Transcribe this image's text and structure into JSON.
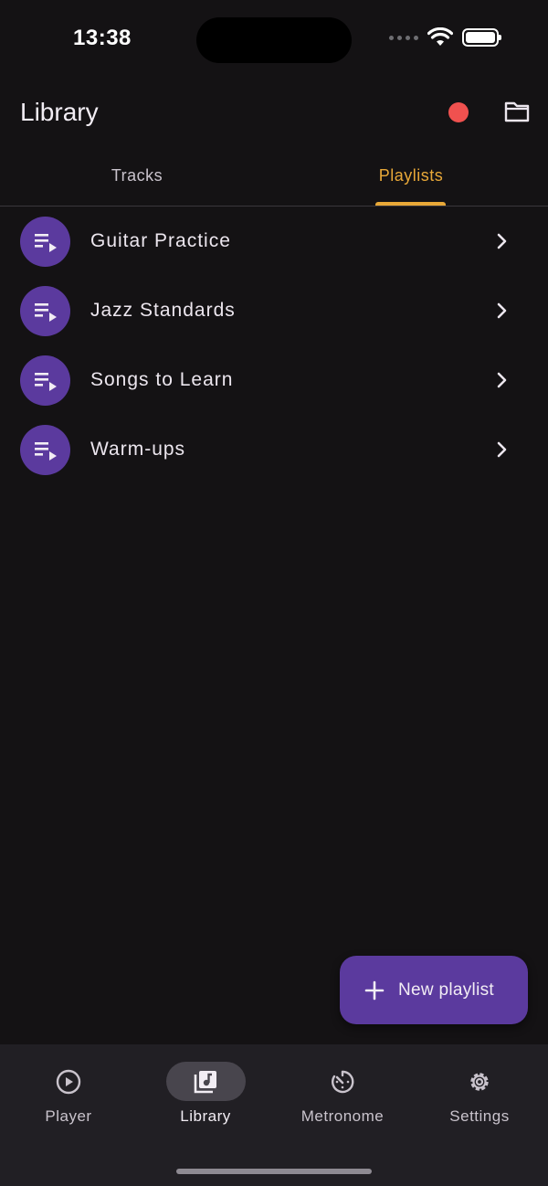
{
  "status_bar": {
    "time": "13:38"
  },
  "app_bar": {
    "title": "Library",
    "record_color": "#F0514F"
  },
  "tabs": [
    {
      "label": "Tracks",
      "active": false
    },
    {
      "label": "Playlists",
      "active": true
    }
  ],
  "accent_color": "#E8A838",
  "playlists": [
    {
      "label": "Guitar Practice"
    },
    {
      "label": "Jazz Standards"
    },
    {
      "label": "Songs to Learn"
    },
    {
      "label": "Warm-ups"
    }
  ],
  "fab": {
    "label": "New playlist",
    "icon": "plus-icon",
    "color": "#5B3A9E"
  },
  "bottom_nav": [
    {
      "label": "Player",
      "icon": "play-circle-icon",
      "active": false
    },
    {
      "label": "Library",
      "icon": "library-music-icon",
      "active": true
    },
    {
      "label": "Metronome",
      "icon": "timer-icon",
      "active": false
    },
    {
      "label": "Settings",
      "icon": "gear-icon",
      "active": false
    }
  ]
}
